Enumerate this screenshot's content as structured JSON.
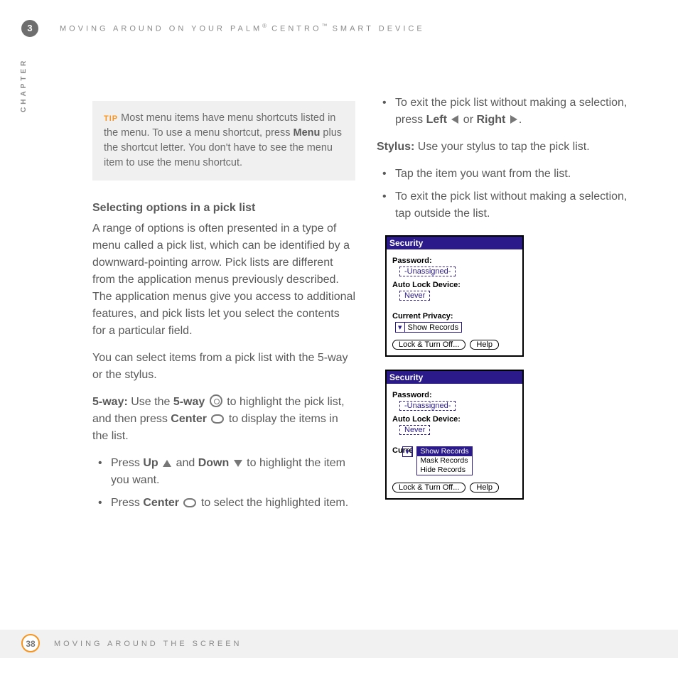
{
  "header": {
    "chapter_num": "3",
    "title_pre": "MOVING AROUND ON YOUR PALM",
    "title_mid": " CENTRO",
    "title_post": " SMART DEVICE",
    "side_label": "CHAPTER"
  },
  "tip": {
    "label": "TIP",
    "t1": "Most menu items have menu shortcuts listed in the menu. To use a menu shortcut, press ",
    "menu": "Menu",
    "t2": " plus the shortcut letter. You don't have to see the menu item to use the menu shortcut."
  },
  "section_heading": "Selecting options in a pick list",
  "para1": "A range of options is often presented in a type of menu called a pick list, which can be identified by a downward-pointing arrow. Pick lists are different from the application menus previously described. The application menus give you access to additional features, and pick lists let you select the contents for a particular field.",
  "para2": "You can select items from a pick list with the 5-way or the stylus.",
  "fiveway": {
    "label": "5-way:",
    "t1": " Use the ",
    "b1": "5-way",
    "t2": " to highlight the pick list, and then press ",
    "b2": "Center",
    "t3": " to display the items in the list."
  },
  "bullets_left": {
    "b1a": "Press ",
    "b1u": "Up",
    "b1m": " and ",
    "b1d": "Down",
    "b1z": " to highlight the item you want.",
    "b2a": "Press ",
    "b2c": "Center",
    "b2z": " to select the highlighted item."
  },
  "bullets_right_top": {
    "b1a": "To exit the pick list without making a selection, press ",
    "b1l": "Left",
    "b1m": " or ",
    "b1r": "Right",
    "b1z": "."
  },
  "stylus": {
    "label": "Stylus:",
    "text": " Use your stylus to tap the pick list."
  },
  "bullets_right_bot": {
    "b1": "Tap the item you want from the list.",
    "b2": "To exit the pick list without making a selection, tap outside the list."
  },
  "shot": {
    "title": "Security",
    "password": "Password:",
    "unassigned": "-Unassigned-",
    "autolock": "Auto Lock Device:",
    "never": "Never",
    "privacy": "Current Privacy:",
    "privacy_short": "Curre",
    "show": "Show Records",
    "mask": "Mask Records",
    "hide": "Hide Records",
    "lock": "Lock & Turn Off...",
    "help": "Help"
  },
  "footer": {
    "page": "38",
    "text": "MOVING AROUND THE SCREEN"
  }
}
